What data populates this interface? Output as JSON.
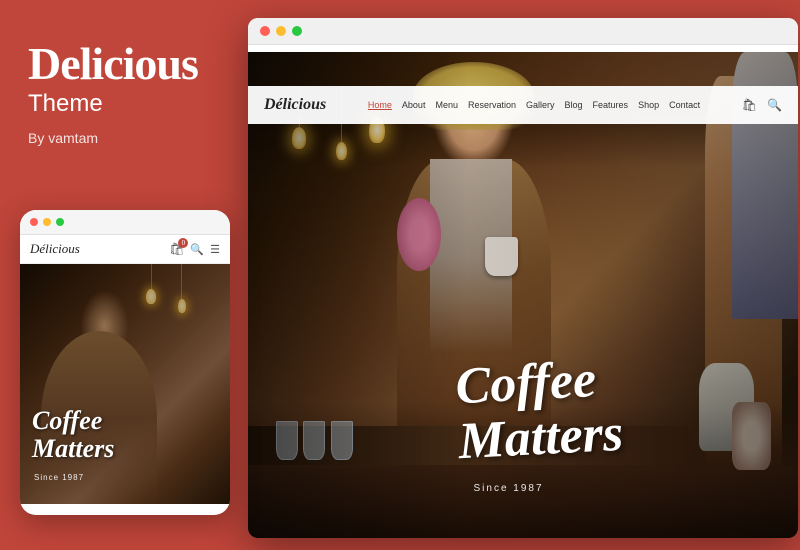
{
  "left_panel": {
    "title": "Delicious",
    "subtitle": "Theme",
    "author_label": "By vamtam"
  },
  "mobile_preview": {
    "logo": "Délicious",
    "traffic_lights": [
      "red",
      "yellow",
      "green"
    ],
    "coffee_text_line1": "Coffee",
    "coffee_text_line2": "Matters",
    "since": "Since 1987"
  },
  "desktop_preview": {
    "logo": "Délicious",
    "traffic_lights": [
      "red",
      "yellow",
      "green"
    ],
    "nav_links": [
      {
        "label": "Home",
        "active": true
      },
      {
        "label": "About",
        "active": false
      },
      {
        "label": "Menu",
        "active": false
      },
      {
        "label": "Reservation",
        "active": false
      },
      {
        "label": "Gallery",
        "active": false
      },
      {
        "label": "Blog",
        "active": false
      },
      {
        "label": "Features",
        "active": false
      },
      {
        "label": "Shop",
        "active": false
      },
      {
        "label": "Contact",
        "active": false
      }
    ],
    "coffee_text_line1": "Coffee",
    "coffee_text_line2": "Matters",
    "since": "Since 1987"
  },
  "colors": {
    "brand_red": "#c0453a",
    "dark_bg": "#2a1a08",
    "white": "#ffffff"
  }
}
